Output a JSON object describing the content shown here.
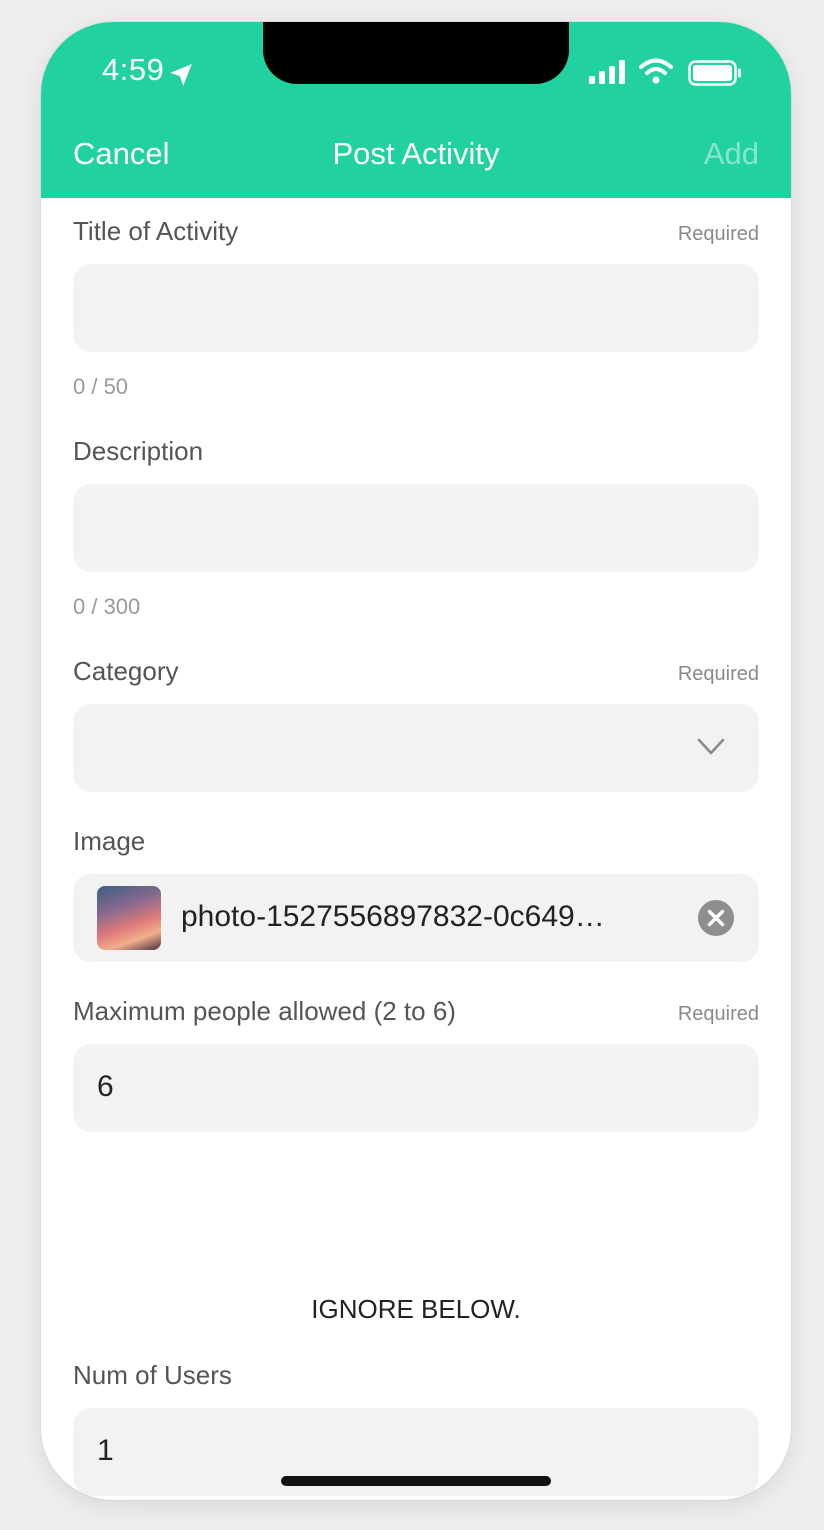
{
  "status_bar": {
    "time": "4:59"
  },
  "nav": {
    "cancel": "Cancel",
    "title": "Post Activity",
    "add": "Add"
  },
  "form": {
    "title": {
      "label": "Title of Activity",
      "required": "Required",
      "value": "",
      "counter": "0 / 50"
    },
    "description": {
      "label": "Description",
      "value": "",
      "counter": "0 / 300"
    },
    "category": {
      "label": "Category",
      "required": "Required",
      "value": ""
    },
    "image": {
      "label": "Image",
      "filename": "photo-1527556897832-0c649…"
    },
    "max_people": {
      "label": "Maximum people allowed (2 to 6)",
      "required": "Required",
      "value": "6"
    },
    "ignore_note": "IGNORE BELOW.",
    "num_users": {
      "label": "Num of Users",
      "value": "1"
    }
  },
  "colors": {
    "accent": "#22d1a0",
    "field_bg": "#f2f2f2"
  }
}
